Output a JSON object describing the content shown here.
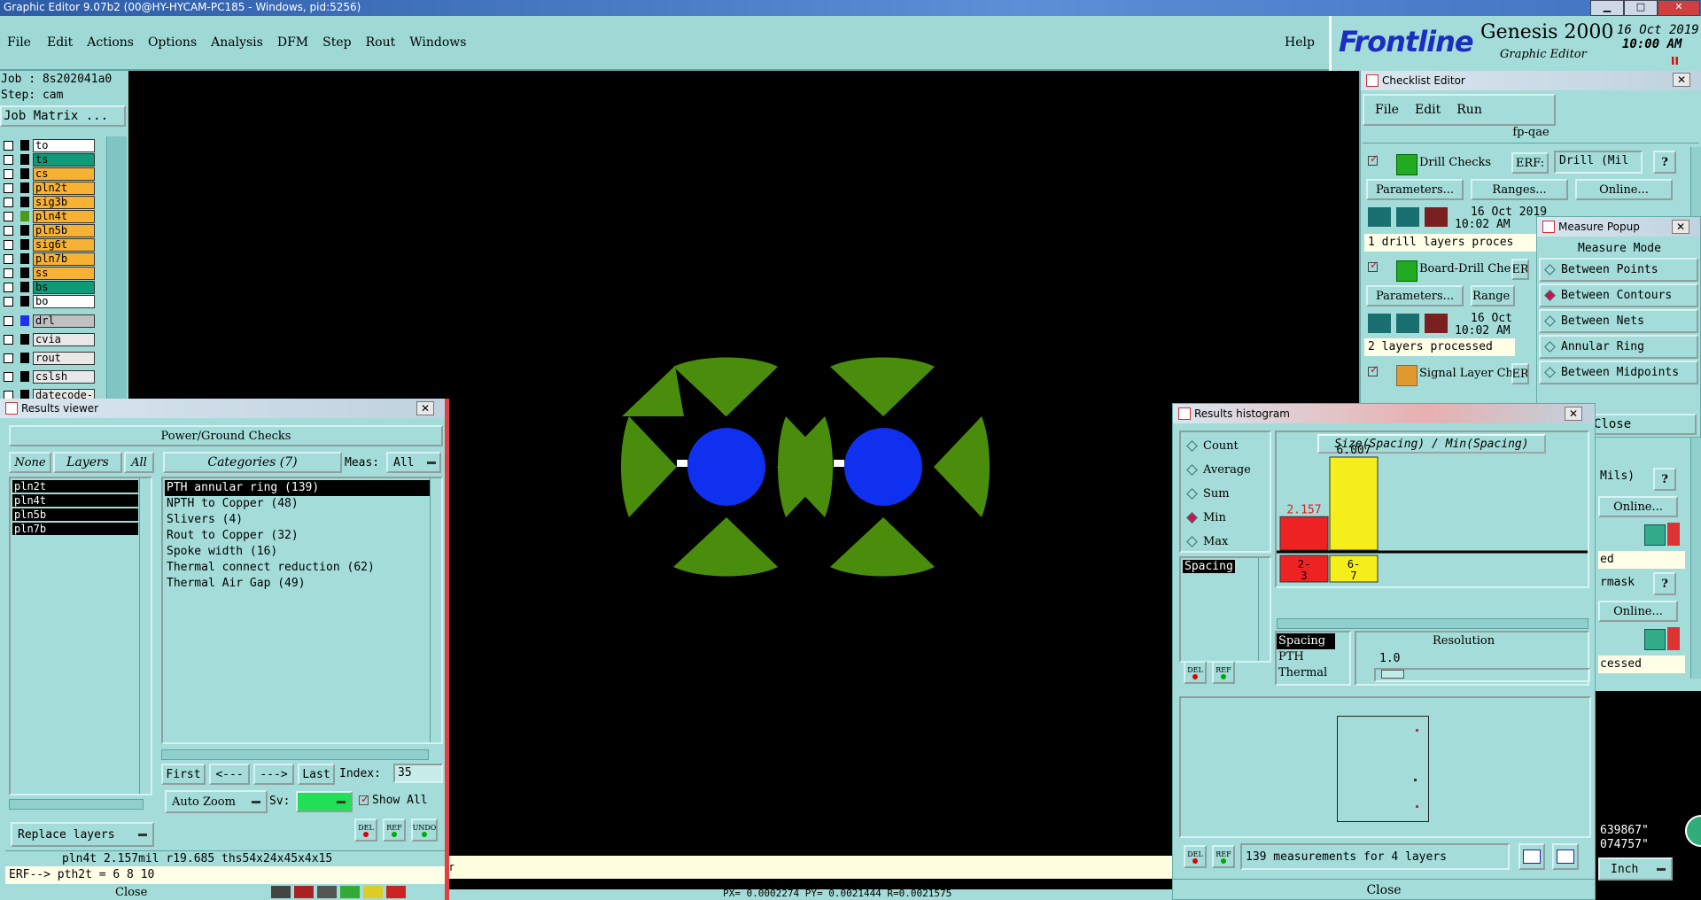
{
  "titlebar": {
    "title": "Graphic Editor 9.07b2 (00@HY-HYCAM-PC185 - Windows, pid:5256)"
  },
  "menubar": {
    "items": [
      "File",
      "Edit",
      "Actions",
      "Options",
      "Analysis",
      "DFM",
      "Step",
      "Rout",
      "Windows"
    ],
    "help": "Help"
  },
  "brand": {
    "logo": "Frontline",
    "product": "Genesis 2000",
    "subtitle": "Graphic Editor",
    "date": "16 Oct 2019",
    "time": "10:00 AM"
  },
  "job": {
    "job": "Job : 8s202041a0",
    "step": "Step: cam",
    "matrix_button": "Job Matrix ..."
  },
  "layers": [
    {
      "name": "to",
      "color": "#ffffff"
    },
    {
      "name": "ts",
      "color": "#0f9a78"
    },
    {
      "name": "cs",
      "color": "#f7b233"
    },
    {
      "name": "pln2t",
      "color": "#f7b233"
    },
    {
      "name": "sig3b",
      "color": "#f7b233"
    },
    {
      "name": "pln4t",
      "color": "#f7b233"
    },
    {
      "name": "pln5b",
      "color": "#f7b233"
    },
    {
      "name": "sig6t",
      "color": "#f7b233"
    },
    {
      "name": "pln7b",
      "color": "#f7b233"
    },
    {
      "name": "ss",
      "color": "#f7b233"
    },
    {
      "name": "bs",
      "color": "#0f9a78"
    },
    {
      "name": "bo",
      "color": "#ffffff"
    },
    {
      "name": "drl",
      "color": "#c0c0c0"
    },
    {
      "name": "cvia",
      "color": "#e8e8e8"
    },
    {
      "name": "rout",
      "color": "#e8e8e8"
    },
    {
      "name": "cslsh",
      "color": "#e8e8e8"
    },
    {
      "name": "datecode-pbe",
      "color": "#e8e8e8"
    }
  ],
  "results_viewer": {
    "title": "Results viewer",
    "header": "Power/Ground Checks",
    "filter_none": "None",
    "filter_layers": "Layers",
    "filter_all": "All",
    "categories_label": "Categories (7)",
    "meas_label": "Meas:",
    "meas_value": "All",
    "layers": [
      "pln2t",
      "pln4t",
      "pln5b",
      "pln7b"
    ],
    "categories": [
      "PTH annular ring (139)",
      "NPTH to Copper (48)",
      "Slivers (4)",
      "Rout to Copper (32)",
      "Spoke width (16)",
      "Thermal connect reduction (62)",
      "Thermal Air Gap (49)"
    ],
    "nav": {
      "first": "First",
      "prev": "<---",
      "next": "--->",
      "last": "Last",
      "index_label": "Index:",
      "index_value": "35"
    },
    "auto_zoom": "Auto Zoom",
    "sv_label": "Sv:",
    "show_all": "Show All",
    "replace_layers": "Replace layers",
    "icon_labels": [
      "DEL",
      "REF",
      "UNDO"
    ],
    "status": "pln4t 2.157mil  r19.685  ths54x24x45x4x15",
    "erf_line": "ERF--> pth2t = 6 8 10",
    "close": "Close"
  },
  "checklist": {
    "title": "Checklist Editor",
    "menu": [
      "File",
      "Edit",
      "Run"
    ],
    "name": "fp-qae",
    "checks": [
      {
        "name": "Drill Checks",
        "erf_label": "ERF:",
        "erf_value": "Drill (Mil",
        "params": "Parameters...",
        "ranges": "Ranges...",
        "online": "Online...",
        "date": "16 Oct 2019",
        "time": "10:02 AM",
        "status": "1 drill layers proces"
      },
      {
        "name": "Board-Drill Che",
        "erf_label": "ER",
        "params": "Parameters...",
        "ranges": "Range",
        "date": "16 Oct",
        "time": "10:02 AM",
        "status": "2 layers processed"
      },
      {
        "name": "Signal Layer Ch",
        "erf_label": "ER",
        "params": "Parameters",
        "ranges": "Range"
      }
    ],
    "right_frag": {
      "mils": "Mils)",
      "online1": "Online...",
      "status1": "ed",
      "soldermask": "rmask",
      "online2": "Online...",
      "status2": "cessed",
      "coord1": "639867\"",
      "coord2": "074757\"",
      "unit": "Inch"
    }
  },
  "measure": {
    "title": "Measure Popup",
    "header": "Measure Mode",
    "options": [
      {
        "label": "Between Points",
        "selected": false
      },
      {
        "label": "Between Contours",
        "selected": true
      },
      {
        "label": "Between Nets",
        "selected": false
      },
      {
        "label": "Annular Ring",
        "selected": false
      },
      {
        "label": "Between Midpoints",
        "selected": false
      }
    ],
    "close": "Close"
  },
  "histogram": {
    "title": "Results histogram",
    "stats": [
      {
        "label": "Count",
        "selected": false
      },
      {
        "label": "Average",
        "selected": false
      },
      {
        "label": "Sum",
        "selected": false
      },
      {
        "label": "Min",
        "selected": true
      },
      {
        "label": "Max",
        "selected": false
      }
    ],
    "list_item": "Spacing",
    "chart_title": "Size(Spacing) / Min(Spacing)",
    "bottom_list": [
      "Spacing",
      "PTH",
      "Thermal"
    ],
    "resolution_label": "Resolution",
    "resolution_value": "1.0",
    "status": "139 measurements for 4 layers",
    "close": "Close",
    "icon_labels": [
      "DEL",
      "REF"
    ]
  },
  "chart_data": {
    "type": "bar",
    "title": "Size(Spacing) / Min(Spacing)",
    "categories": [
      "2-3",
      "6-7"
    ],
    "values": [
      2.157,
      6.007
    ],
    "colors": [
      "#ee2222",
      "#f5ee1a"
    ]
  },
  "canvas_status": {
    "coords": "PX= 0.0002274  PY= 0.0021444  R=0.0021575",
    "msg": "er"
  }
}
